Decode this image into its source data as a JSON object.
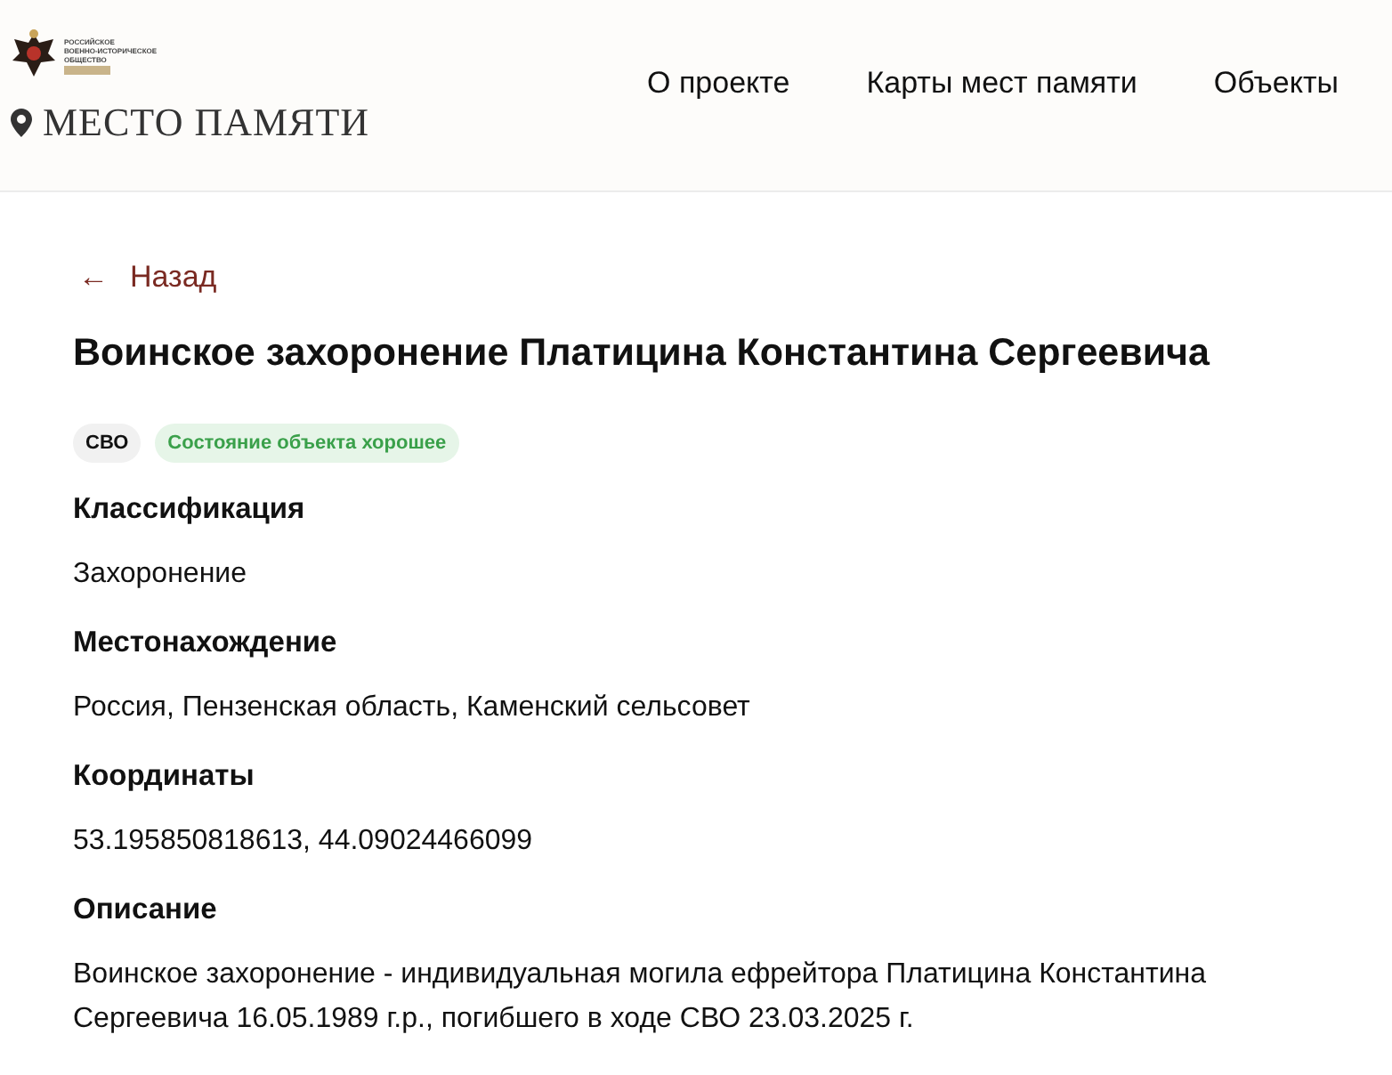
{
  "header": {
    "logo": {
      "org_lines": [
        "РОССИЙСКОЕ",
        "ВОЕННО-ИСТОРИЧЕСКОЕ",
        "ОБЩЕСТВО"
      ],
      "site_name": "МЕСТО ПАМЯТИ"
    },
    "nav": [
      {
        "label": "О проекте"
      },
      {
        "label": "Карты мест памяти"
      },
      {
        "label": "Объекты"
      }
    ]
  },
  "back_link": {
    "icon": "←",
    "label": "Назад"
  },
  "title": "Воинское захоронение Платицина Константина Сергеевича",
  "tags": [
    {
      "label": "СВО",
      "kind": "plain"
    },
    {
      "label": "Состояние объекта хорошее",
      "kind": "status"
    }
  ],
  "fields": [
    {
      "label": "Классификация",
      "value": "Захоронение"
    },
    {
      "label": "Местонахождение",
      "value": "Россия, Пензенская область, Каменский сельсовет"
    },
    {
      "label": "Координаты",
      "value": "53.195850818613, 44.09024466099"
    },
    {
      "label": "Описание",
      "value": "Воинское захоронение - индивидуальная могила ефрейтора Платицина Константина Сергеевича 16.05.1989 г.р., погибшего в ходе СВО 23.03.2025 г."
    }
  ]
}
